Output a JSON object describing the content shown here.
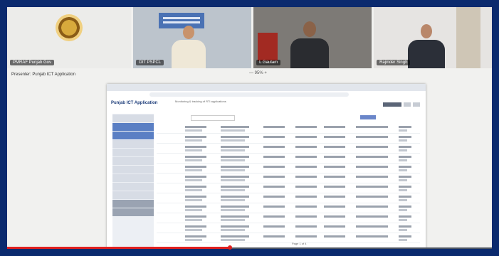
{
  "participants": [
    {
      "name": "PMRAF Punjab Gov"
    },
    {
      "name": "DIT PSPCL"
    },
    {
      "name": "L Gautam"
    },
    {
      "name": "Rajinder Singh"
    }
  ],
  "status_text": "Presenter: Punjab ICT Application",
  "zoom_label": "— 95% +",
  "screen": {
    "app_title": "Punjab ICT Application",
    "app_subtitle": "Monitoring & tracking of RTI applications",
    "pager_text": "Page 1 of 4"
  },
  "progress": 0.46,
  "colors": {
    "border": "#0b2a6e",
    "progress": "#e02020",
    "accent": "#5a7fc4"
  }
}
